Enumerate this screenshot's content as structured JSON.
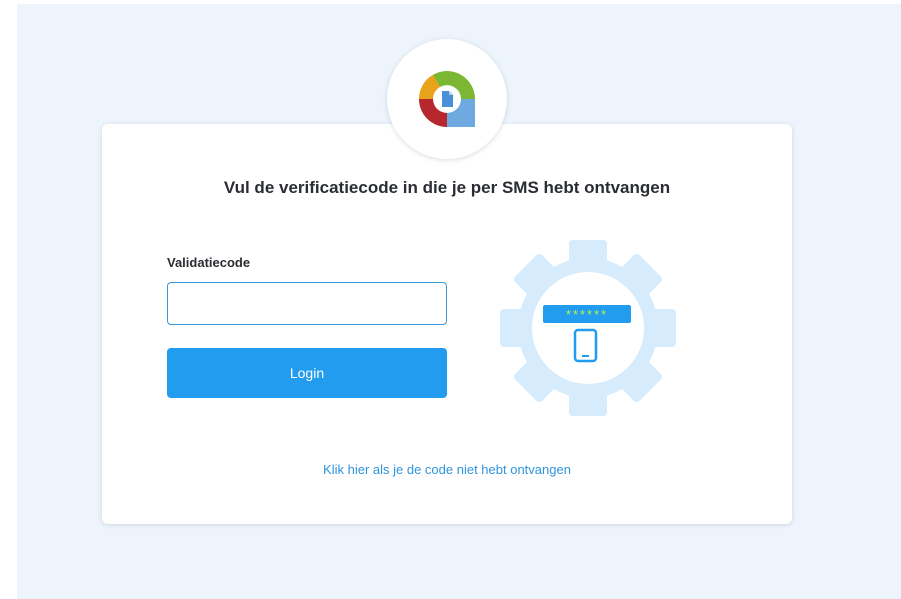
{
  "page": {
    "title": "Vul de verificatiecode in die je per SMS hebt ontvangen"
  },
  "form": {
    "code_label": "Validatiecode",
    "code_value": "",
    "login_label": "Login"
  },
  "links": {
    "resend": "Klik hier als je de code niet hebt ontvangen"
  },
  "illustration": {
    "masked_code": "******",
    "icon": "gear-phone-verification-icon"
  },
  "logo": {
    "icon": "app-logo"
  },
  "colors": {
    "page_background": "#edf4fb",
    "card_background": "#ffffff",
    "primary": "#229cee",
    "link": "#2f95dc",
    "gear": "#d6ebfb",
    "logo_green": "#7cb733",
    "logo_yellow": "#f0b21c",
    "logo_red": "#b7282e",
    "logo_blue": "#6ea9e0"
  }
}
